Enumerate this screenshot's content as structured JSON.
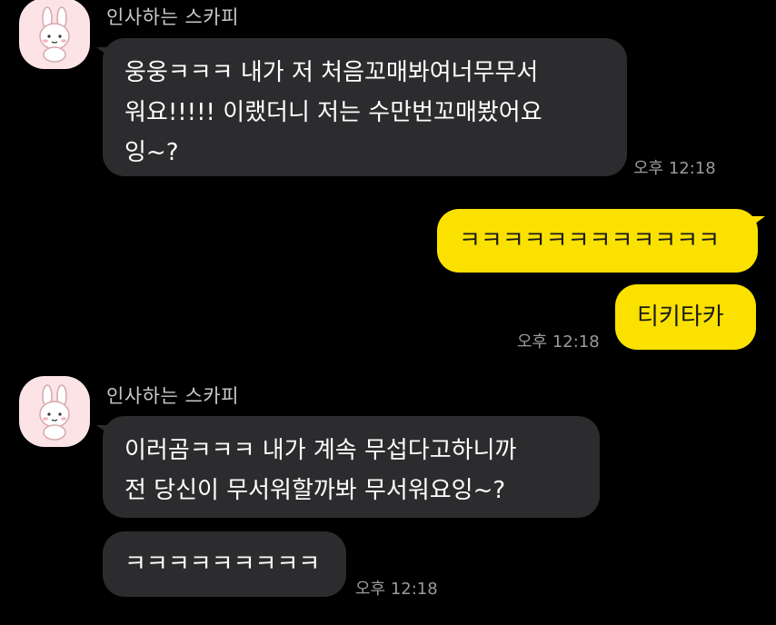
{
  "colors": {
    "background": "#000000",
    "incoming_bubble": "#2c2c2e",
    "outgoing_bubble": "#fae100",
    "avatar_background": "#fbe3e6"
  },
  "messages": {
    "group1": {
      "sender": "인사하는 스카피",
      "avatar_icon": "pink-bunny-icon",
      "bubble1": {
        "lines": [
          "웅웅ㅋㅋㅋ 내가 저 처음꼬매봐여너무무서",
          "워요!!!!! 이랬더니 저는 수만번꼬매봤어요",
          "잉~?"
        ],
        "time": "오후 12:18"
      }
    },
    "group2": {
      "bubble1": {
        "text": "ㅋㅋㅋㅋㅋㅋㅋㅋㅋㅋㅋㅋ"
      },
      "bubble2": {
        "text": "티키타카",
        "time": "오후 12:18"
      }
    },
    "group3": {
      "sender": "인사하는 스카피",
      "avatar_icon": "pink-bunny-icon",
      "bubble1": {
        "lines": [
          "이러곰ㅋㅋㅋ 내가 계속 무섭다고하니까",
          "전 당신이 무서워할까봐 무서워요잉~?"
        ]
      },
      "bubble2": {
        "text": "ㅋㅋㅋㅋㅋㅋㅋㅋㅋ",
        "time": "오후 12:18"
      }
    }
  }
}
